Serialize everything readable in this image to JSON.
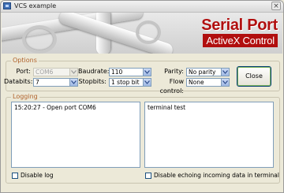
{
  "window": {
    "title": "VCS example"
  },
  "banner": {
    "line1": "Serial Port",
    "line2": "ActiveX Control"
  },
  "options": {
    "legend": "Options",
    "port": {
      "label": "Port:",
      "value": "COM6"
    },
    "databits": {
      "label": "Databits:",
      "value": "7"
    },
    "baudrate": {
      "label": "Baudrate:",
      "value": "110"
    },
    "stopbits": {
      "label": "Stopbits:",
      "value": "1 stop bit"
    },
    "parity": {
      "label": "Parity:",
      "value": "No parity"
    },
    "flow_control": {
      "label": "Flow control:",
      "value": "None"
    },
    "close_button": "Close"
  },
  "logging": {
    "legend": "Logging",
    "log_text": "15:20:27 - Open port COM6",
    "terminal_text": "terminal test",
    "disable_log_label": "Disable log",
    "disable_echo_label": "Disable echoing incoming data in terminal",
    "disable_log_checked": false,
    "disable_echo_checked": false
  }
}
